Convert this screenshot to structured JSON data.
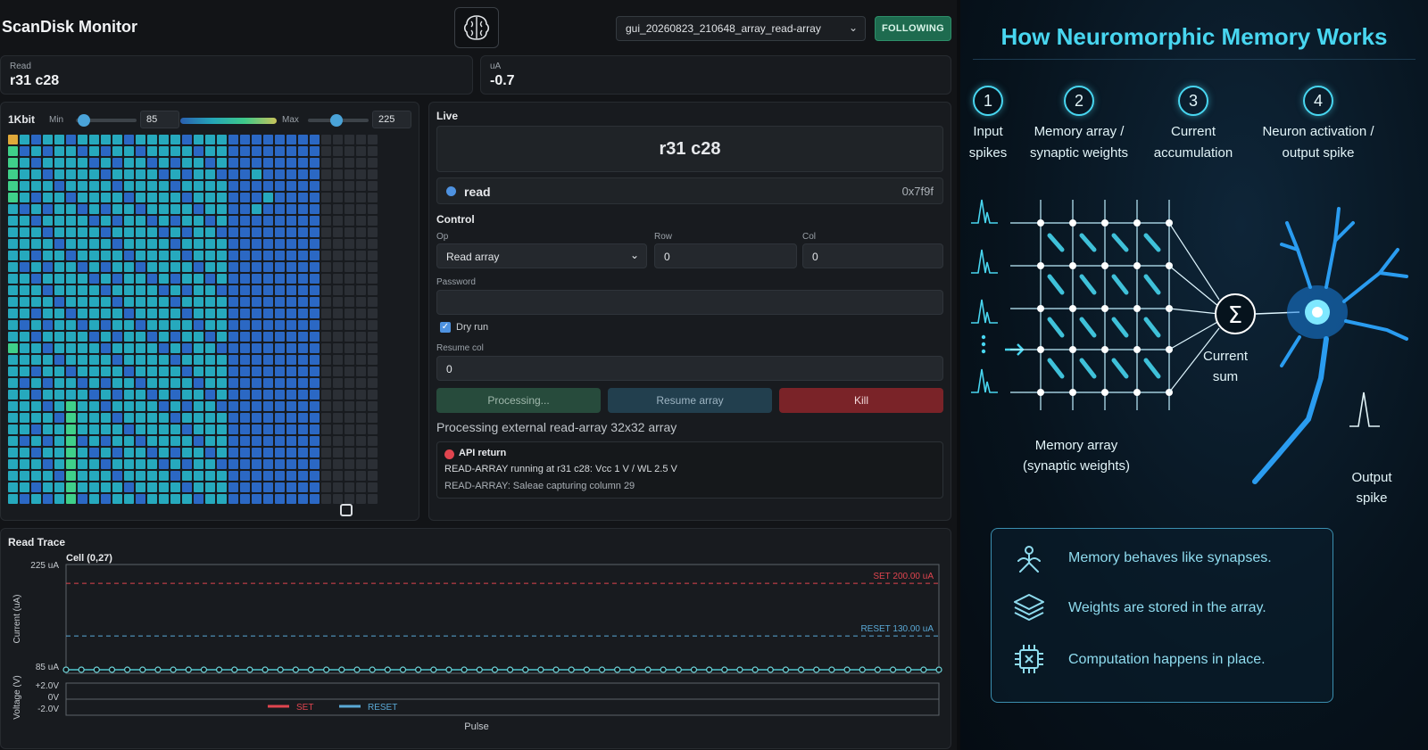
{
  "header": {
    "app_title": "ScanDisk Monitor",
    "session_select": "gui_20260823_210648_array_read-array",
    "follow_button": "FOLLOWING"
  },
  "stats": {
    "read_label": "Read",
    "read_value": "r31 c28",
    "current_label": "uA",
    "current_value": "-0.7"
  },
  "heatmap": {
    "title": "1Kbit",
    "min_label": "Min",
    "min_value": "85",
    "max_label": "Max",
    "max_value": "225",
    "rows": 32,
    "cols": 32,
    "scanned_columns": 27,
    "colors": {
      "low": "#2b68c4",
      "mid": "#26a9bd",
      "high": "#3fd08a",
      "hot": "#e0a93a",
      "empty": "#2b2f35"
    }
  },
  "live": {
    "title": "Live",
    "position": "r31 c28",
    "op_status": "read",
    "op_code": "0x7f9f"
  },
  "control": {
    "title": "Control",
    "op_label": "Op",
    "op_value": "Read array",
    "row_label": "Row",
    "row_value": "0",
    "col_label": "Col",
    "col_value": "0",
    "password_label": "Password",
    "password_value": "",
    "dry_run_label": "Dry run",
    "dry_run_checked": true,
    "resume_col_label": "Resume col",
    "resume_col_value": "0",
    "processing_button": "Processing...",
    "resume_button": "Resume array",
    "kill_button": "Kill",
    "status_text": "Processing external read-array 32x32 array"
  },
  "api": {
    "title": "API return",
    "line1": "READ-ARRAY running at r31 c28: Vcc 1 V / WL 2.5 V",
    "line2": "READ-ARRAY: Saleae capturing column 29"
  },
  "trace": {
    "title": "Read Trace",
    "cell_label": "Cell (0,27)",
    "y_label_current": "Current (uA)",
    "y_label_voltage": "Voltage (V)",
    "x_label": "Pulse",
    "tick_225": "225 uA",
    "tick_85": "85 uA",
    "v_ticks": [
      "+2.0V",
      "0V",
      "-2.0V"
    ],
    "set_line": "SET 200.00 uA",
    "reset_line": "RESET 130.00 uA",
    "legend_set": "SET",
    "legend_reset": "RESET"
  },
  "chart_data": {
    "type": "line",
    "title": "Cell (0,27)",
    "xlabel": "Pulse",
    "ylabel": "Current (uA)",
    "ylim": [
      85,
      225
    ],
    "series": [
      {
        "name": "read",
        "values": [
          85,
          85,
          85,
          85,
          85,
          85,
          85,
          85,
          85,
          85,
          85,
          85,
          85,
          85,
          85,
          85,
          85,
          85,
          85,
          85,
          85,
          85,
          85,
          85,
          85,
          85,
          85,
          85,
          85,
          85,
          85,
          85,
          85,
          85,
          85,
          85,
          85,
          85,
          85,
          85,
          85,
          85,
          85,
          85,
          85,
          85,
          85,
          85,
          85,
          85,
          85,
          85,
          85,
          85,
          85,
          85,
          85,
          85
        ]
      }
    ],
    "thresholds": [
      {
        "name": "SET",
        "value": 200,
        "color": "#e0454f"
      },
      {
        "name": "RESET",
        "value": 130,
        "color": "#5aa9d6"
      }
    ]
  },
  "infographic": {
    "title": "How Neuromorphic Memory Works",
    "steps": [
      {
        "num": "1",
        "line1": "Input",
        "line2": "spikes"
      },
      {
        "num": "2",
        "line1": "Memory array /",
        "line2": "synaptic weights"
      },
      {
        "num": "3",
        "line1": "Current",
        "line2": "accumulation"
      },
      {
        "num": "4",
        "line1": "Neuron activation /",
        "line2": "output spike"
      }
    ],
    "sum_symbol": "Σ",
    "current_sum_1": "Current",
    "current_sum_2": "sum",
    "array_label_1": "Memory array",
    "array_label_2": "(synaptic weights)",
    "output_1": "Output",
    "output_2": "spike",
    "key_points": [
      "Memory behaves like synapses.",
      "Weights are stored in the array.",
      "Computation happens in place."
    ]
  }
}
